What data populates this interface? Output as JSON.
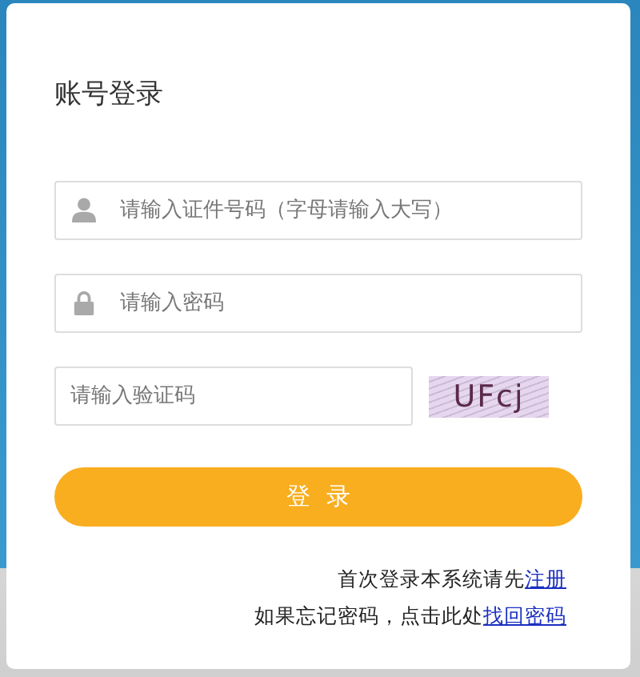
{
  "title": "账号登录",
  "fields": [
    {
      "kind": "user",
      "placeholder": "请输入证件号码（字母请输入大写）"
    },
    {
      "kind": "password",
      "placeholder": "请输入密码"
    }
  ],
  "captcha": {
    "placeholder": "请输入验证码",
    "code": "UFcj"
  },
  "login_button": "登  录",
  "footer": [
    {
      "text": "首次登录本系统请先",
      "link": "注册"
    },
    {
      "text": "如果忘记密码，点击此处",
      "link": "找回密码"
    }
  ]
}
